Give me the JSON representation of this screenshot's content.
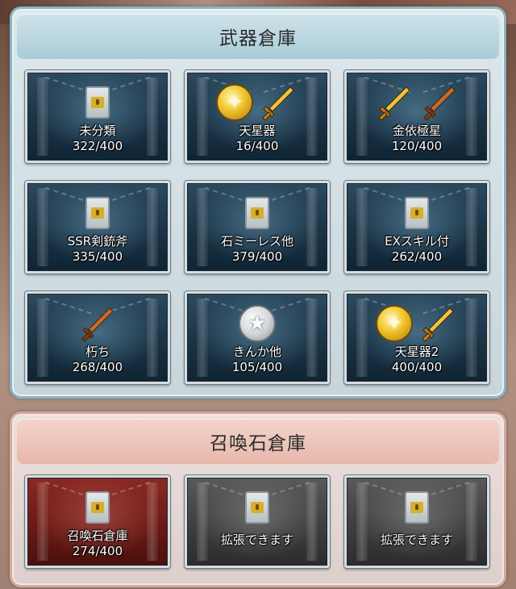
{
  "weapon_storage": {
    "title": "武器倉庫",
    "boxes": [
      {
        "name": "未分類",
        "count": "322/400",
        "icons": [
          "lock"
        ]
      },
      {
        "name": "天星器",
        "count": "16/400",
        "icons": [
          "gold-star",
          "gold-sword"
        ]
      },
      {
        "name": "金依極星",
        "count": "120/400",
        "icons": [
          "gold-sword",
          "rust-sword"
        ]
      },
      {
        "name": "SSR剣銃斧",
        "count": "335/400",
        "icons": [
          "lock"
        ]
      },
      {
        "name": "石ミーレス他",
        "count": "379/400",
        "icons": [
          "lock"
        ]
      },
      {
        "name": "EXスキル付",
        "count": "262/400",
        "icons": [
          "lock"
        ]
      },
      {
        "name": "朽ち",
        "count": "268/400",
        "icons": [
          "rust-sword"
        ]
      },
      {
        "name": "きんか他",
        "count": "105/400",
        "icons": [
          "silver-star"
        ]
      },
      {
        "name": "天星器2",
        "count": "400/400",
        "icons": [
          "gold-star",
          "gold-sword"
        ]
      }
    ]
  },
  "summon_storage": {
    "title": "召喚石倉庫",
    "boxes": [
      {
        "name": "召喚石倉庫",
        "count": "274/400",
        "icons": [
          "lock"
        ]
      },
      {
        "name": "拡張できます",
        "count": "",
        "icons": [
          "lock"
        ]
      },
      {
        "name": "拡張できます",
        "count": "",
        "icons": [
          "lock"
        ]
      }
    ]
  },
  "icons": {
    "lock": "lock-icon",
    "gold-star": "gold-star-medal-icon",
    "silver-star": "silver-star-medal-icon",
    "gold-sword": "gold-sword-icon",
    "rust-sword": "rusted-sword-icon"
  },
  "colors": {
    "weapon_panel_border": "#8ab4c4",
    "summon_panel_border": "#d4a8a0",
    "box_blue": "#1a3446",
    "box_red": "#6a1a16",
    "box_gray": "#3e3e3e"
  }
}
